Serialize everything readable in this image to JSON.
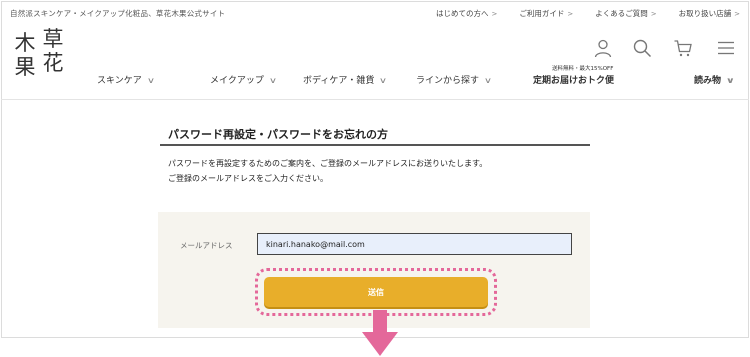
{
  "header": {
    "tagline": "自然派スキンケア・メイクアップ化粧品、草花木果公式サイト",
    "top_links": [
      {
        "label": "はじめての方へ",
        "chevron": ">"
      },
      {
        "label": "ご利用ガイド",
        "chevron": ">"
      },
      {
        "label": "よくあるご質問",
        "chevron": ">"
      },
      {
        "label": "お取り扱い店舗",
        "chevron": ">"
      }
    ],
    "logo": {
      "chars": [
        "木",
        "草",
        "果",
        "花"
      ]
    },
    "icons": [
      "user-icon",
      "search-icon",
      "cart-icon",
      "menu-icon"
    ],
    "nav": [
      {
        "label": "スキンケア",
        "chevron": "∨"
      },
      {
        "label": "メイクアップ",
        "chevron": "∨"
      },
      {
        "label": "ボディケア・雑貨",
        "chevron": "∨"
      },
      {
        "label": "ラインから探す",
        "chevron": "∨"
      },
      {
        "label": "定期お届けおトク便",
        "note": "送料無料・最大15%OFF"
      },
      {
        "label": "読み物",
        "chevron": "∨"
      }
    ]
  },
  "main": {
    "title": "パスワード再設定・パスワードをお忘れの方",
    "description": [
      "パスワードを再設定するためのご案内を、ご登録のメールアドレスにお送りいたします。",
      "ご登録のメールアドレスをご入力ください。"
    ],
    "form": {
      "email_label": "メールアドレス",
      "email_value": "kinari.hanako@mail.com",
      "submit_label": "送信"
    }
  },
  "colors": {
    "accent": "#e8ae2a",
    "highlight": "#e4689a",
    "input_bg": "#e8effb",
    "form_bg": "#f6f4ee"
  }
}
